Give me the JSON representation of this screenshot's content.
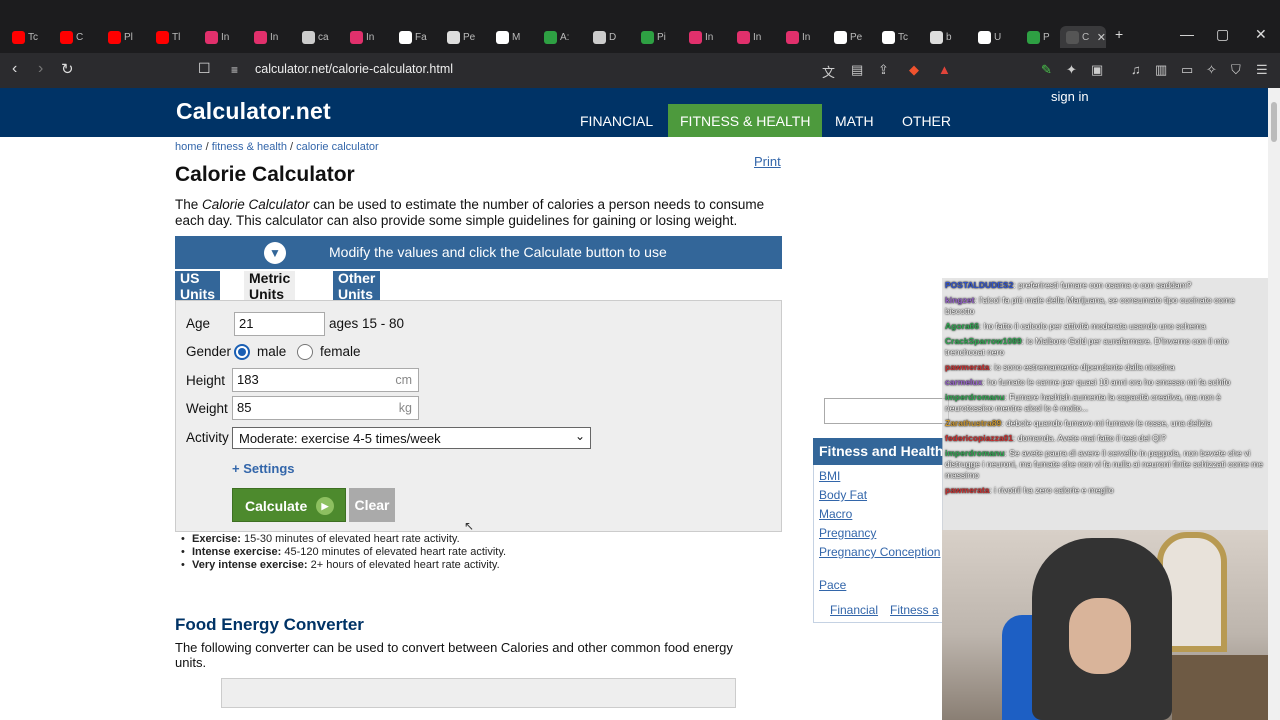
{
  "browser": {
    "tabs": [
      {
        "label": "Tc",
        "color": "#ff0000"
      },
      {
        "label": "C",
        "color": "#ff0000"
      },
      {
        "label": "Pl",
        "color": "#ff0000"
      },
      {
        "label": "Tl",
        "color": "#ff0000"
      },
      {
        "label": "In",
        "color": "#e1306c"
      },
      {
        "label": "In",
        "color": "#e1306c"
      },
      {
        "label": "ca",
        "color": "#cccccc"
      },
      {
        "label": "In",
        "color": "#e1306c"
      },
      {
        "label": "Fa",
        "color": "#ffffff"
      },
      {
        "label": "Pe",
        "color": "#dddddd"
      },
      {
        "label": "M",
        "color": "#ffffff"
      },
      {
        "label": "A:",
        "color": "#2ea043"
      },
      {
        "label": "D",
        "color": "#cccccc"
      },
      {
        "label": "Pi",
        "color": "#2ea043"
      },
      {
        "label": "In",
        "color": "#e1306c"
      },
      {
        "label": "In",
        "color": "#e1306c"
      },
      {
        "label": "In",
        "color": "#e1306c"
      },
      {
        "label": "Pe",
        "color": "#ffffff"
      },
      {
        "label": "Tc",
        "color": "#ffffff"
      },
      {
        "label": "b",
        "color": "#dddddd"
      },
      {
        "label": "U",
        "color": "#ffffff"
      },
      {
        "label": "P",
        "color": "#2ea043"
      },
      {
        "label": "C",
        "color": "#555555"
      }
    ],
    "url": "calculator.net/calorie-calculator.html"
  },
  "site": {
    "logo": "Calculator.net",
    "nav": [
      "FINANCIAL",
      "FITNESS & HEALTH",
      "MATH",
      "OTHER"
    ],
    "signin": "sign in",
    "accent": "#003366",
    "active_nav_color": "#4d9a3d"
  },
  "breadcrumb": [
    "home",
    "fitness & health",
    "calorie calculator"
  ],
  "print": "Print",
  "title": "Calorie Calculator",
  "intro_prefix": "The ",
  "intro_em": "Calorie Calculator",
  "intro_rest": " can be used to estimate the number of calories a person needs to consume each day. This calculator can also provide some simple guidelines for gaining or losing weight.",
  "banner": "Modify the values and click the Calculate button to use",
  "unit_tabs": [
    "US Units",
    "Metric Units",
    "Other Units"
  ],
  "form": {
    "age_label": "Age",
    "age_value": "21",
    "age_hint": "ages 15 - 80",
    "gender_label": "Gender",
    "gender_male": "male",
    "gender_female": "female",
    "height_label": "Height",
    "height_value": "183",
    "height_unit": "cm",
    "weight_label": "Weight",
    "weight_value": "85",
    "weight_unit": "kg",
    "activity_label": "Activity",
    "activity_value": "Moderate: exercise 4-5 times/week",
    "settings": "+ Settings",
    "calculate": "Calculate",
    "clear": "Clear"
  },
  "notes": [
    {
      "b": "Exercise:",
      "t": " 15-30 minutes of elevated heart rate activity."
    },
    {
      "b": "Intense exercise:",
      "t": " 45-120 minutes of elevated heart rate activity."
    },
    {
      "b": "Very intense exercise:",
      "t": " 2+ hours of elevated heart rate activity."
    }
  ],
  "food_energy": {
    "title": "Food Energy Converter",
    "text": "The following converter can be used to convert between Calories and other common food energy units."
  },
  "sidebar": {
    "head": "Fitness and Health Calculators",
    "links": [
      "BMI",
      "Body Fat",
      "Macro",
      "Pregnancy",
      "Pregnancy Conception",
      "Pace"
    ],
    "footer_links": [
      "Financial",
      "Fitness a"
    ]
  },
  "chat": [
    {
      "u": "POSTALDUDES2",
      "m": ": preferiresti fumare con osama o con saddam?",
      "c": "#3355cc"
    },
    {
      "u": "kingzet",
      "m": ": l'alcol fa più male della Marijuana, se consumato tipo cucinato come biscotto",
      "c": "#9966cc"
    },
    {
      "u": "Agora66",
      "m": ": ho fatto il calcolo per attività moderata usando uno schema",
      "c": "#33aa55"
    },
    {
      "u": "CrackSparrow1089",
      "m": ": io Malboro Gold per aurafarmare. D'inverno con il mio trenchcoat nero",
      "c": "#33aa55"
    },
    {
      "u": "pawmerata",
      "m": ": io sono estremamente dipendente dalla nicotina",
      "c": "#cc3333"
    },
    {
      "u": "carmelux",
      "m": ": ho fumato le canne per quasi 10 anni ora ho smesso mi fa schifo",
      "c": "#9966cc"
    },
    {
      "u": "imperdromanu",
      "m": ": Fumare hashish aumenta la capacità creativa, ma non è neurotossico mentre alcol lo è molto...",
      "c": "#33aa55"
    },
    {
      "u": "Zarathustra89",
      "m": ": debole quando fumavo mi fumavo le rosse, una delizia",
      "c": "#cc9933"
    },
    {
      "u": "federicopiazza01",
      "m": ": domanda. Avete mai fatto il test del QI?",
      "c": "#cc3333"
    },
    {
      "u": "imperdromanu",
      "m": ": Se avete paura di avere il cervello in pappola, non bevete che vi distrugge i neuroni, ma fumate che non vi fa nulla ai neuroni finite schizzati come me massimo",
      "c": "#33aa55"
    },
    {
      "u": "pawmerata",
      "m": ": i rivotril ha zero calorie e meglio",
      "c": "#cc3333"
    }
  ]
}
